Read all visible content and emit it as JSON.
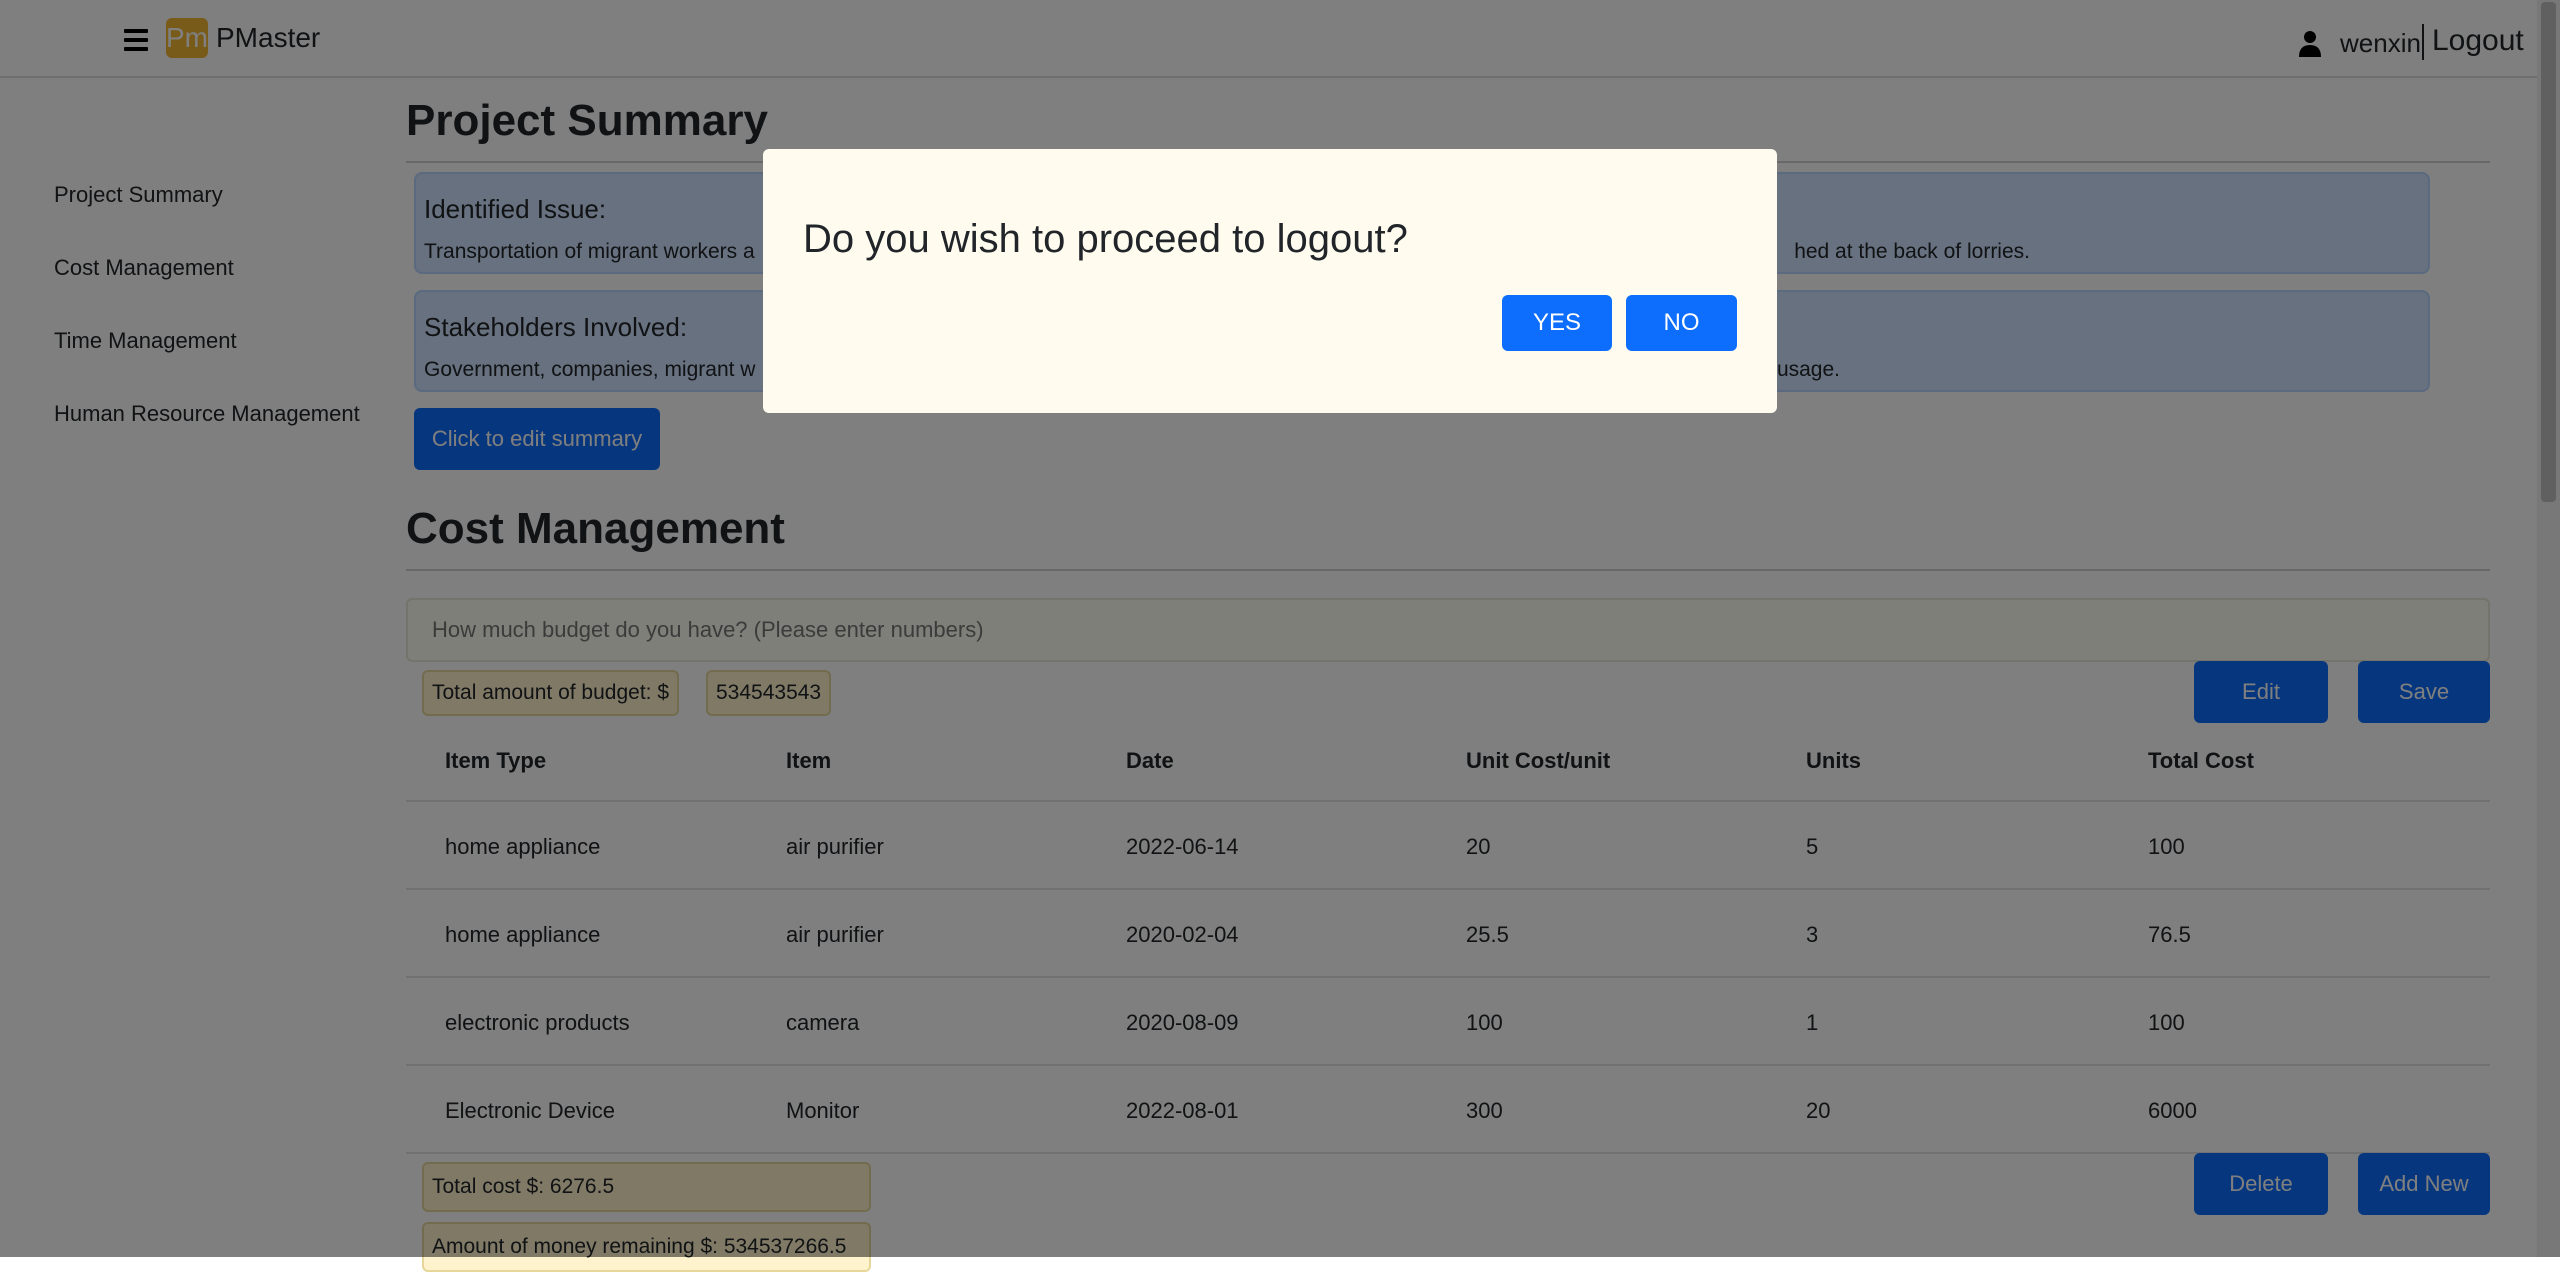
{
  "navbar": {
    "logo_text": "Pm",
    "brand": "PMaster",
    "username": "wenxin",
    "logout_label": "Logout"
  },
  "sidebar": {
    "items": [
      {
        "label": "Project Summary"
      },
      {
        "label": "Cost Management"
      },
      {
        "label": "Time Management"
      },
      {
        "label": "Human Resource Management"
      }
    ]
  },
  "project_summary": {
    "title": "Project Summary",
    "issue": {
      "heading": "Identified Issue:",
      "text_start": "Transportation of migrant workers a",
      "text_end": "hed at the back of lorries."
    },
    "stakeholders": {
      "heading": "Stakeholders Involved:",
      "text_start": "Government, companies, migrant w",
      "text_end": "usage."
    },
    "edit_button": "Click to edit summary"
  },
  "cost_management": {
    "title": "Cost Management",
    "budget_placeholder": "How much budget do you have? (Please enter numbers)",
    "budget_label": "Total amount of budget: $",
    "budget_value": "534543543",
    "edit_button": "Edit",
    "save_button": "Save",
    "table": {
      "headers": [
        "Item Type",
        "Item",
        "Date",
        "Unit Cost/unit",
        "Units",
        "Total Cost"
      ],
      "rows": [
        [
          "home appliance",
          "air purifier",
          "2022-06-14",
          "20",
          "5",
          "100"
        ],
        [
          "home appliance",
          "air purifier",
          "2020-02-04",
          "25.5",
          "3",
          "76.5"
        ],
        [
          "electronic products",
          "camera",
          "2020-08-09",
          "100",
          "1",
          "100"
        ],
        [
          "Electronic Device",
          "Monitor",
          "2022-08-01",
          "300",
          "20",
          "6000"
        ]
      ]
    },
    "total_cost": "Total cost $: 6276.5",
    "remaining": "Amount of money remaining $: 534537266.5",
    "delete_button": "Delete",
    "add_new_button": "Add New"
  },
  "modal": {
    "message": "Do you wish to proceed to logout?",
    "yes_label": "YES",
    "no_label": "NO"
  },
  "colors": {
    "primary": "#0d6efd",
    "logo": "#f2b632",
    "card_bg": "#cfe2ff",
    "tag_bg": "#fff3cd",
    "modal_bg": "#fffcef"
  }
}
